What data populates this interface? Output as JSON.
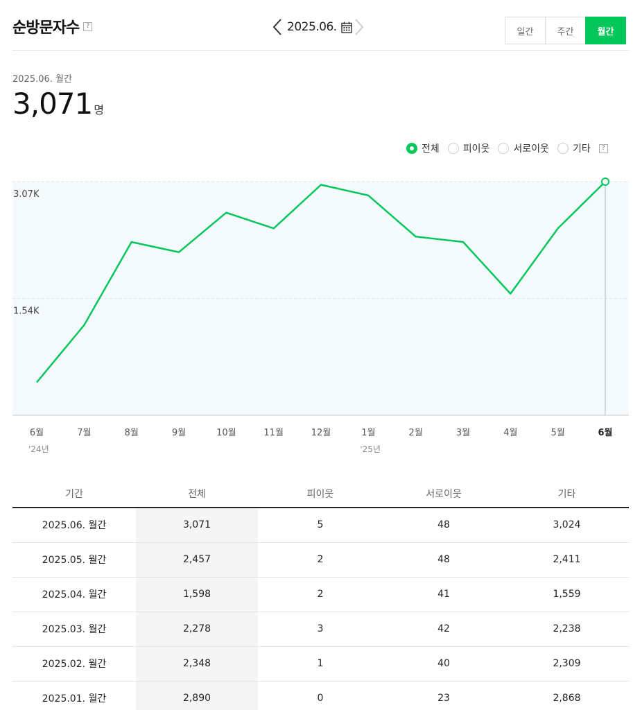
{
  "header": {
    "title": "순방문자수",
    "help_label": "?",
    "date": "2025.06.",
    "tabs": [
      {
        "label": "일간",
        "active": false
      },
      {
        "label": "주간",
        "active": false
      },
      {
        "label": "월간",
        "active": true
      }
    ]
  },
  "summary": {
    "period": "2025.06. 월간",
    "value": "3,071",
    "unit": "명"
  },
  "legend": {
    "items": [
      {
        "label": "전체",
        "checked": true
      },
      {
        "label": "피이웃",
        "checked": false
      },
      {
        "label": "서로이웃",
        "checked": false
      },
      {
        "label": "기타",
        "checked": false
      }
    ],
    "help_label": "?"
  },
  "colors": {
    "accent": "#03c75a",
    "chart_bg": "#f4fafd"
  },
  "chart_data": {
    "type": "line",
    "categories": [
      "6월",
      "7월",
      "8월",
      "9월",
      "10월",
      "11월",
      "12월",
      "1월",
      "2월",
      "3월",
      "4월",
      "5월",
      "6월"
    ],
    "year_labels": [
      {
        "index": 0,
        "label": "'24년"
      },
      {
        "index": 7,
        "label": "'25년"
      }
    ],
    "series": [
      {
        "values": [
          434,
          1185,
          2278,
          2144,
          2664,
          2457,
          3030,
          2890,
          2348,
          2278,
          1598,
          2457,
          3071
        ]
      }
    ],
    "yticks": [
      {
        "value": 1535,
        "label": "1.54K"
      },
      {
        "value": 3071,
        "label": "3.07K"
      }
    ],
    "ylim": [
      0,
      3071
    ],
    "highlight_index": 12,
    "grid": true
  },
  "table": {
    "headers": [
      "기간",
      "전체",
      "피이웃",
      "서로이웃",
      "기타"
    ],
    "rows": [
      [
        "2025.06. 월간",
        "3,071",
        "5",
        "48",
        "3,024"
      ],
      [
        "2025.05. 월간",
        "2,457",
        "2",
        "48",
        "2,411"
      ],
      [
        "2025.04. 월간",
        "1,598",
        "2",
        "41",
        "1,559"
      ],
      [
        "2025.03. 월간",
        "2,278",
        "3",
        "42",
        "2,238"
      ],
      [
        "2025.02. 월간",
        "2,348",
        "1",
        "40",
        "2,309"
      ],
      [
        "2025.01. 월간",
        "2,890",
        "0",
        "23",
        "2,868"
      ]
    ]
  }
}
